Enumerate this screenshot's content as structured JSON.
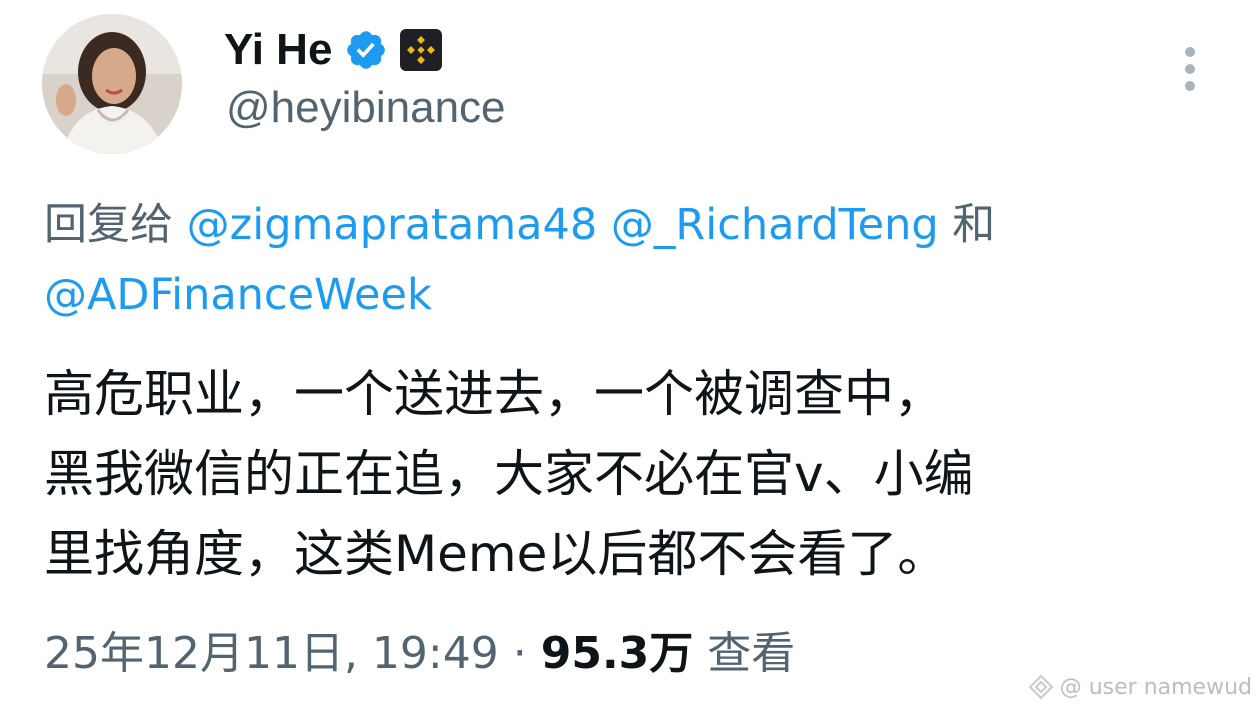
{
  "author": {
    "display_name": "Yi He",
    "handle": "@heyibinance",
    "verified_icon": "verified-badge-icon",
    "affiliate_icon": "binance-logo-icon"
  },
  "reply_to": {
    "prefix": "回复给 ",
    "mentions": [
      "@zigmapratama48",
      "@_RichardTeng",
      "@ADFinanceWeek"
    ],
    "conjunction": " 和 "
  },
  "tweet": {
    "text": "高危职业，一个送进去，一个被调查中，\n黑我微信的正在追，大家不必在官v、小编\n里找角度，这类Meme以后都不会看了。"
  },
  "meta": {
    "timestamp": "25年12月11日, 19:49",
    "separator": " · ",
    "views_count": "95.3万",
    "views_label": " 查看"
  },
  "watermark": {
    "text": "@ user namewud"
  },
  "colors": {
    "accent": "#1d9bf0",
    "secondary_text": "#536471",
    "primary_text": "#0f1419"
  }
}
